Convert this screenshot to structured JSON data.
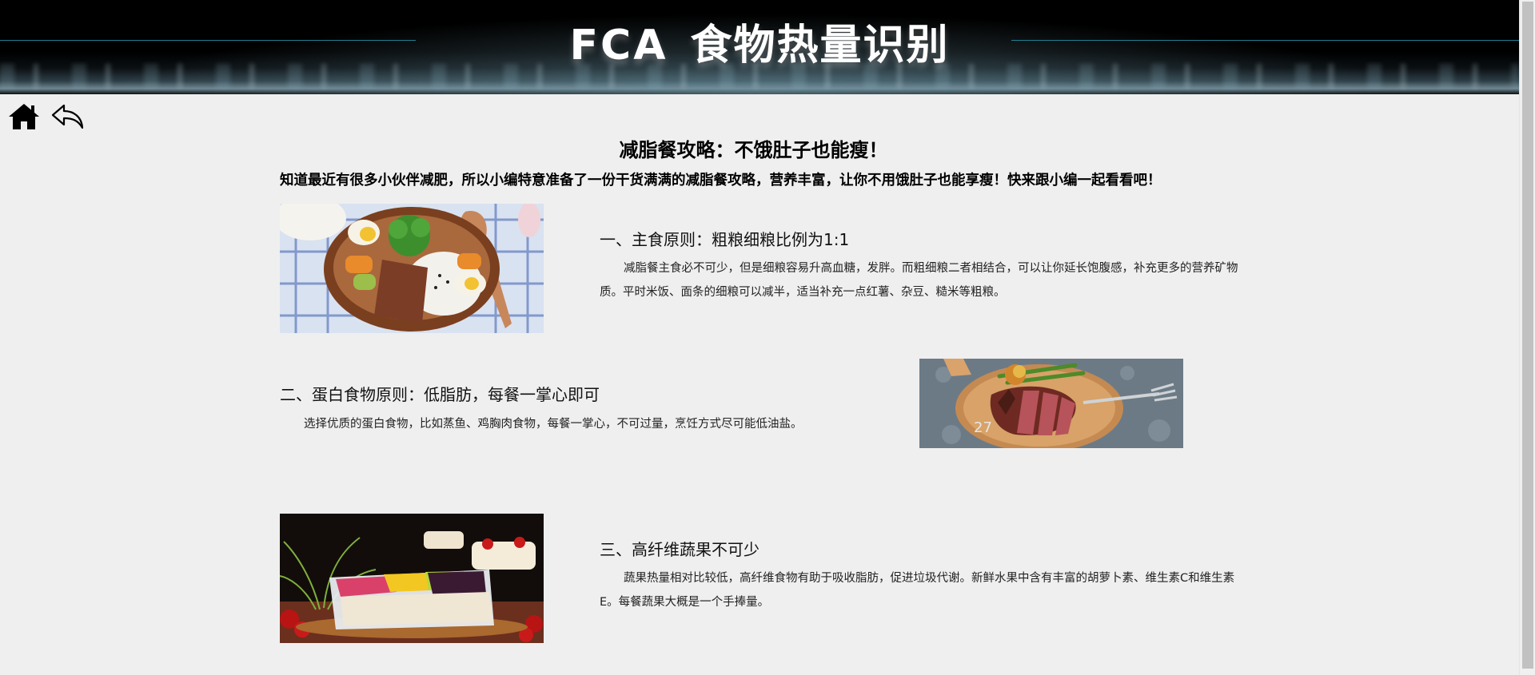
{
  "header": {
    "brand": "FCA",
    "title": "食物热量识别"
  },
  "nav": {
    "home_icon": "home-icon",
    "back_icon": "back-arrow-icon"
  },
  "article": {
    "title": "减脂餐攻略：不饿肚子也能瘦！",
    "intro": "知道最近有很多小伙伴减肥，所以小编特意准备了一份干货满满的减脂餐攻略，营养丰富，让你不用饿肚子也能享瘦！快来跟小编一起看看吧！",
    "sections": [
      {
        "heading": "一、主食原则：粗粮细粮比例为1:1",
        "text": "减脂餐主食必不可少，但是细粮容易升高血糖，发胖。而粗细粮二者相结合，可以让你延长饱腹感，补充更多的营养矿物质。平时米饭、面条的细粮可以减半，适当补充一点红薯、杂豆、糙米等粗粮。"
      },
      {
        "heading": "二、蛋白食物原则：低脂肪，每餐一掌心即可",
        "text": "选择优质的蛋白食物，比如蒸鱼、鸡胸肉食物，每餐一掌心，不可过量，烹饪方式尽可能低油盐。"
      },
      {
        "heading": "三、高纤维蔬果不可少",
        "text": "蔬果热量相对比较低，高纤维食物有助于吸收脂肪，促进垃圾代谢。新鲜水果中含有丰富的胡萝卜素、维生素C和维生素E。每餐蔬果大概是一个手捧量。"
      }
    ]
  },
  "colors": {
    "background": "#efefef",
    "header_bg": "#000000",
    "header_line": "#1f7f93"
  }
}
